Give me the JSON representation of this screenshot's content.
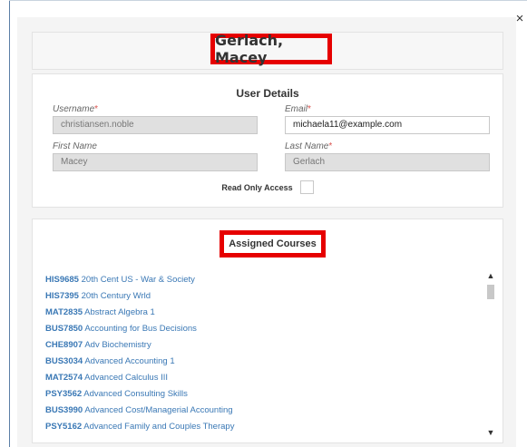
{
  "dialog": {
    "close_icon": "×",
    "user_name": "Gerlach, Macey"
  },
  "user_details": {
    "heading": "User Details",
    "username": {
      "label": "Username",
      "required": "*",
      "value": "christiansen.noble"
    },
    "email": {
      "label": "Email",
      "required": "*",
      "value": "michaela11@example.com"
    },
    "first_name": {
      "label": "First Name",
      "value": "Macey"
    },
    "last_name": {
      "label": "Last Name",
      "required": "*",
      "value": "Gerlach"
    },
    "read_only_access": {
      "label": "Read Only Access",
      "checked": false
    }
  },
  "assigned_courses": {
    "heading": "Assigned Courses",
    "scroll_up_icon": "▲",
    "scroll_down_icon": "▼",
    "items": [
      {
        "code": "HIS9685",
        "name": "20th Cent US - War & Society"
      },
      {
        "code": "HIS7395",
        "name": "20th Century Wrld"
      },
      {
        "code": "MAT2835",
        "name": "Abstract Algebra 1"
      },
      {
        "code": "BUS7850",
        "name": "Accounting for Bus Decisions"
      },
      {
        "code": "CHE8907",
        "name": "Adv Biochemistry"
      },
      {
        "code": "BUS3034",
        "name": "Advanced Accounting 1"
      },
      {
        "code": "MAT2574",
        "name": "Advanced Calculus III"
      },
      {
        "code": "PSY3562",
        "name": "Advanced Consulting Skills"
      },
      {
        "code": "BUS3990",
        "name": "Advanced Cost/Managerial Accounting"
      },
      {
        "code": "PSY5162",
        "name": "Advanced Family and Couples Therapy"
      }
    ]
  }
}
